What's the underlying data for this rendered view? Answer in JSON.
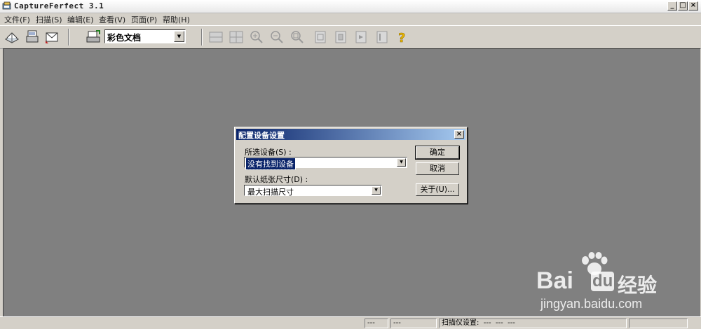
{
  "window": {
    "title": "CaptureFerfect 3.1",
    "controls": [
      "_",
      "□",
      "×"
    ]
  },
  "menu": {
    "items": [
      "文件(F)",
      "扫描(S)",
      "编辑(E)",
      "查看(V)",
      "页面(P)",
      "帮助(H)"
    ]
  },
  "toolbar": {
    "profile_combo_value": "彩色文档",
    "icons": [
      "scan-book-icon",
      "scan-pages-icon",
      "scan-email-icon",
      "scanner-settings-icon",
      "split-horizontal-icon",
      "split-quad-icon",
      "zoom-in-icon",
      "zoom-out-icon",
      "zoom-fit-icon",
      "page-first-icon",
      "page-prev-icon",
      "page-next-icon",
      "page-last-icon",
      "help-icon"
    ]
  },
  "dialog": {
    "title": "配置设备设置",
    "device_label": "所选设备(S) :",
    "device_value": "没有找到设备",
    "paper_label": "默认纸张尺寸(D) :",
    "paper_value": "最大扫描尺寸",
    "ok_label": "确定",
    "cancel_label": "取消",
    "about_label": "关于(U)...",
    "close_glyph": "×"
  },
  "statusbar": {
    "cell1": "---",
    "cell2": "---",
    "cell3": "",
    "cell4": "扫描仪设置:  ---  ---  ---"
  },
  "watermark": {
    "brand": "Bai",
    "brand_du": "du",
    "brand_cn": "经验",
    "url": "jingyan.baidu.com"
  },
  "colors": {
    "workspace": "#808080",
    "chrome": "#d4d0c8",
    "dialog_title": "#0a246a",
    "help_icon": "#e8b400"
  }
}
